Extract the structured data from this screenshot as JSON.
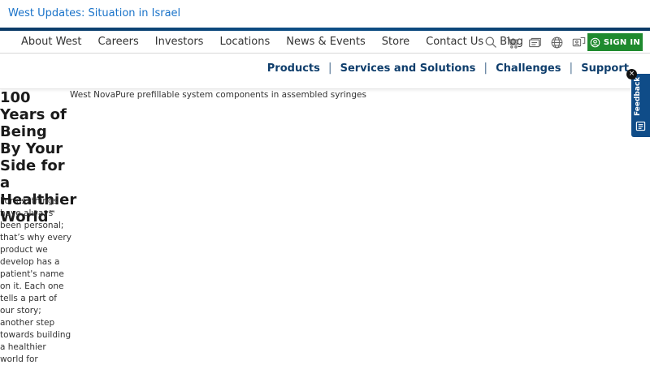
{
  "alert": {
    "text": "West Updates: Situation in Israel"
  },
  "topnav": {
    "items": [
      "About West",
      "Careers",
      "Investors",
      "Locations",
      "News & Events",
      "Store",
      "Contact Us",
      "Blog"
    ],
    "icons": [
      "search-icon",
      "cart-icon",
      "catalog-icon",
      "globe-icon",
      "language-icon"
    ],
    "signin_label": "SIGN IN",
    "colors": {
      "signin": "#1f8a2e",
      "stripe": "#0d4f87"
    }
  },
  "mainnav": {
    "items": [
      "Products",
      "Services and Solutions",
      "Challenges",
      "Support"
    ],
    "color": "#0f3e6c"
  },
  "hero": {
    "title": "100 Years of Being By Your Side for a Healthier World",
    "trademark": "™",
    "copy": "For us, things have always been personal; that’s why every product we develop has a patient's name on it. Each one tells a part of our story; another step towards building a healthier world for everyone",
    "image_alt": "West NovaPure prefillable system components in assembled syringes"
  },
  "feedback": {
    "label": "Feedback",
    "close": "×"
  }
}
